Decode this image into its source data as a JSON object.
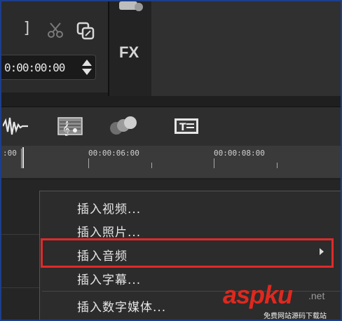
{
  "preview": {
    "bracket": "]",
    "timecode": "0:00:00:00",
    "fx_label": "FX"
  },
  "toolbar": {
    "icons": [
      "audio-waveform-icon",
      "music-score-icon",
      "color-circles-icon",
      "title-text-icon"
    ]
  },
  "ruler": {
    "labels": [
      ":00",
      "00:00:06:00",
      "00:00:08:00"
    ]
  },
  "context_menu": {
    "items": [
      {
        "label": "插入视频..."
      },
      {
        "label": "插入照片..."
      },
      {
        "label": "插入音频",
        "has_submenu": true,
        "highlighted": true
      },
      {
        "label": "插入字幕..."
      },
      {
        "label": "插入数字媒体..."
      }
    ],
    "highlight_color": "#e02a2a"
  },
  "watermark": {
    "logo": "aspku",
    "suffix": ".net",
    "sub": "免费网站源码下载站"
  }
}
